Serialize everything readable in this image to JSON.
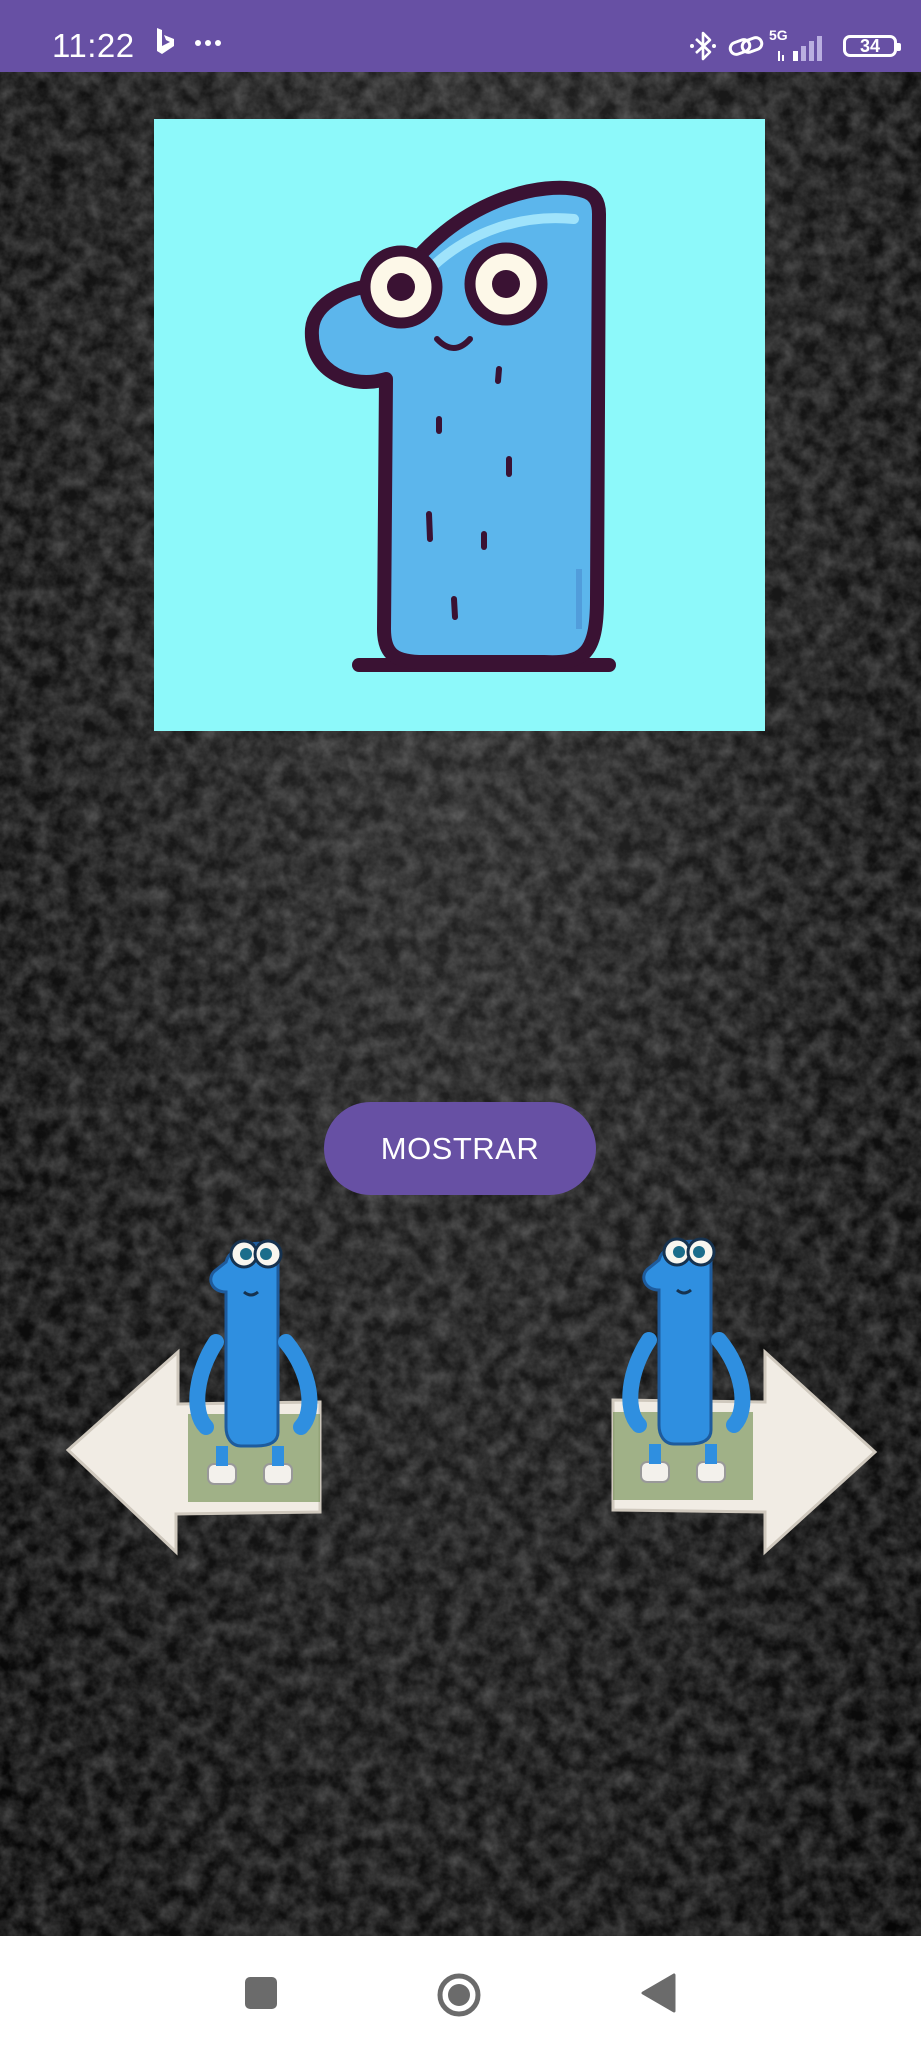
{
  "status_bar": {
    "time": "11:22",
    "network": "5G",
    "battery": "34",
    "bg_color": "#6750A4"
  },
  "icons": {
    "status": [
      "bing-icon",
      "more-icon",
      "bluetooth-icon",
      "link-icon",
      "signal-icon",
      "battery-icon"
    ],
    "navigation": [
      "recent-apps-icon",
      "home-icon",
      "back-icon"
    ]
  },
  "main": {
    "number_card_bg": "#8DF9FA",
    "show_button_label": "MOSTRAR",
    "accent": "#6750A4"
  }
}
